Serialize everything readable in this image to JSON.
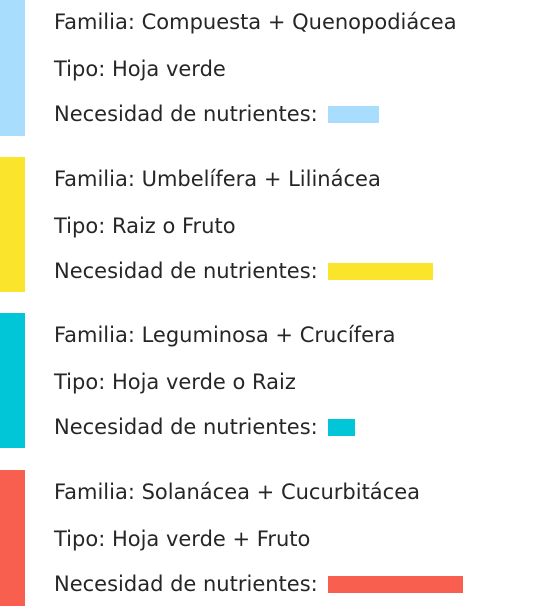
{
  "groups": [
    {
      "familia": "Familia: Compuesta + Quenopodiácea",
      "tipo": "Tipo: Hoja verde",
      "necesidad_label": "Necesidad de nutrientes:",
      "nutrient_level": 0.38,
      "color": "#a8ddfd"
    },
    {
      "familia": "Familia: Umbelífera + Lilinácea",
      "tipo": "Tipo: Raiz o Fruto",
      "necesidad_label": "Necesidad de nutrientes:",
      "nutrient_level": 0.78,
      "color": "#fae52c"
    },
    {
      "familia": "Familia: Leguminosa + Crucífera",
      "tipo": "Tipo: Hoja verde o Raiz",
      "necesidad_label": "Necesidad de nutrientes:",
      "nutrient_level": 0.2,
      "color": "#00c6d8"
    },
    {
      "familia": "Familia: Solanácea + Cucurbitácea",
      "tipo": "Tipo: Hoja verde + Fruto",
      "necesidad_label": "Necesidad de nutrientes:",
      "nutrient_level": 1.0,
      "color": "#f95f4f"
    }
  ]
}
